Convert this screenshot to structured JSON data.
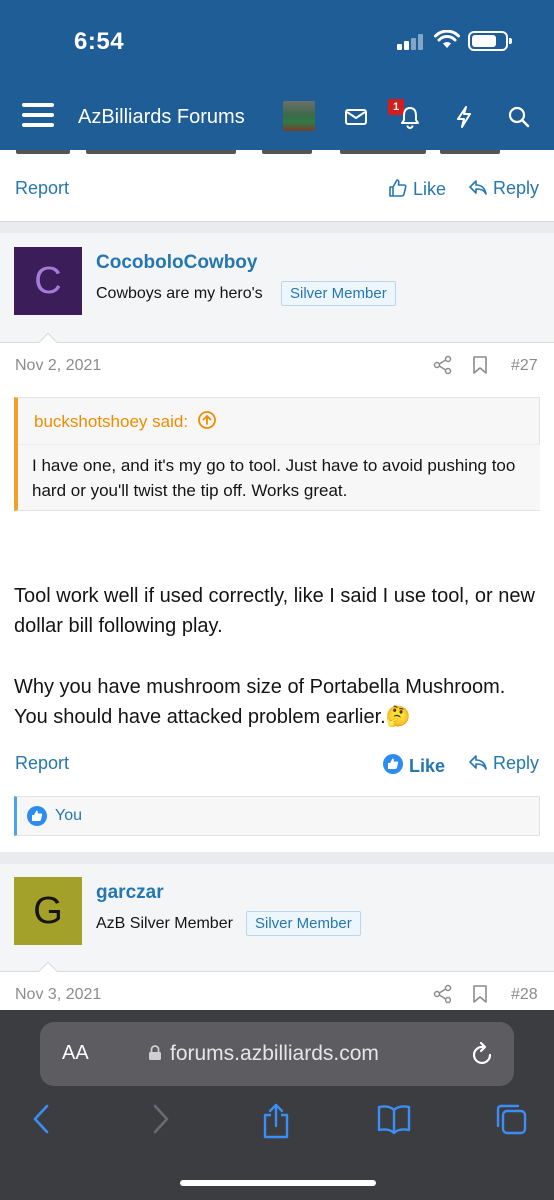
{
  "status_bar": {
    "time": "6:54"
  },
  "header": {
    "site_title": "AzBilliards Forums",
    "notification_count": "1"
  },
  "prev_post": {
    "report_label": "Report",
    "like_label": "Like",
    "reply_label": "Reply"
  },
  "post_27": {
    "avatar_letter": "C",
    "avatar_color": "#3b1d5a",
    "username": "CocoboloCowboy",
    "user_title": "Cowboys are my hero's",
    "badge": "Silver Member",
    "date": "Nov 2, 2021",
    "number": "#27",
    "quote": {
      "author": "buckshotshoey said:",
      "text": "I have one, and it's my go to tool. Just have to avoid pushing too hard or you'll twist the tip off. Works great."
    },
    "paragraphs": [
      "Tool work well if used correctly, like I said I use tool, or new dollar bill following play.",
      "Why you have mushroom size of Portabella Mushroom. You should have attacked problem earlier."
    ],
    "emoji": "🤔",
    "report_label": "Report",
    "like_label": "Like",
    "reply_label": "Reply",
    "reactions_text": "You"
  },
  "post_28": {
    "avatar_letter": "G",
    "avatar_color": "#a3a12a",
    "username": "garczar",
    "user_title": "AzB Silver Member",
    "badge": "Silver Member",
    "date": "Nov 3, 2021",
    "number": "#28"
  },
  "browser": {
    "aa_label": "AA",
    "url": "forums.azbilliards.com"
  },
  "colors": {
    "header_bg": "#1f5d97",
    "link": "#2577b1",
    "quote_accent": "#f3a02a",
    "badge_red": "#d41e1e"
  }
}
